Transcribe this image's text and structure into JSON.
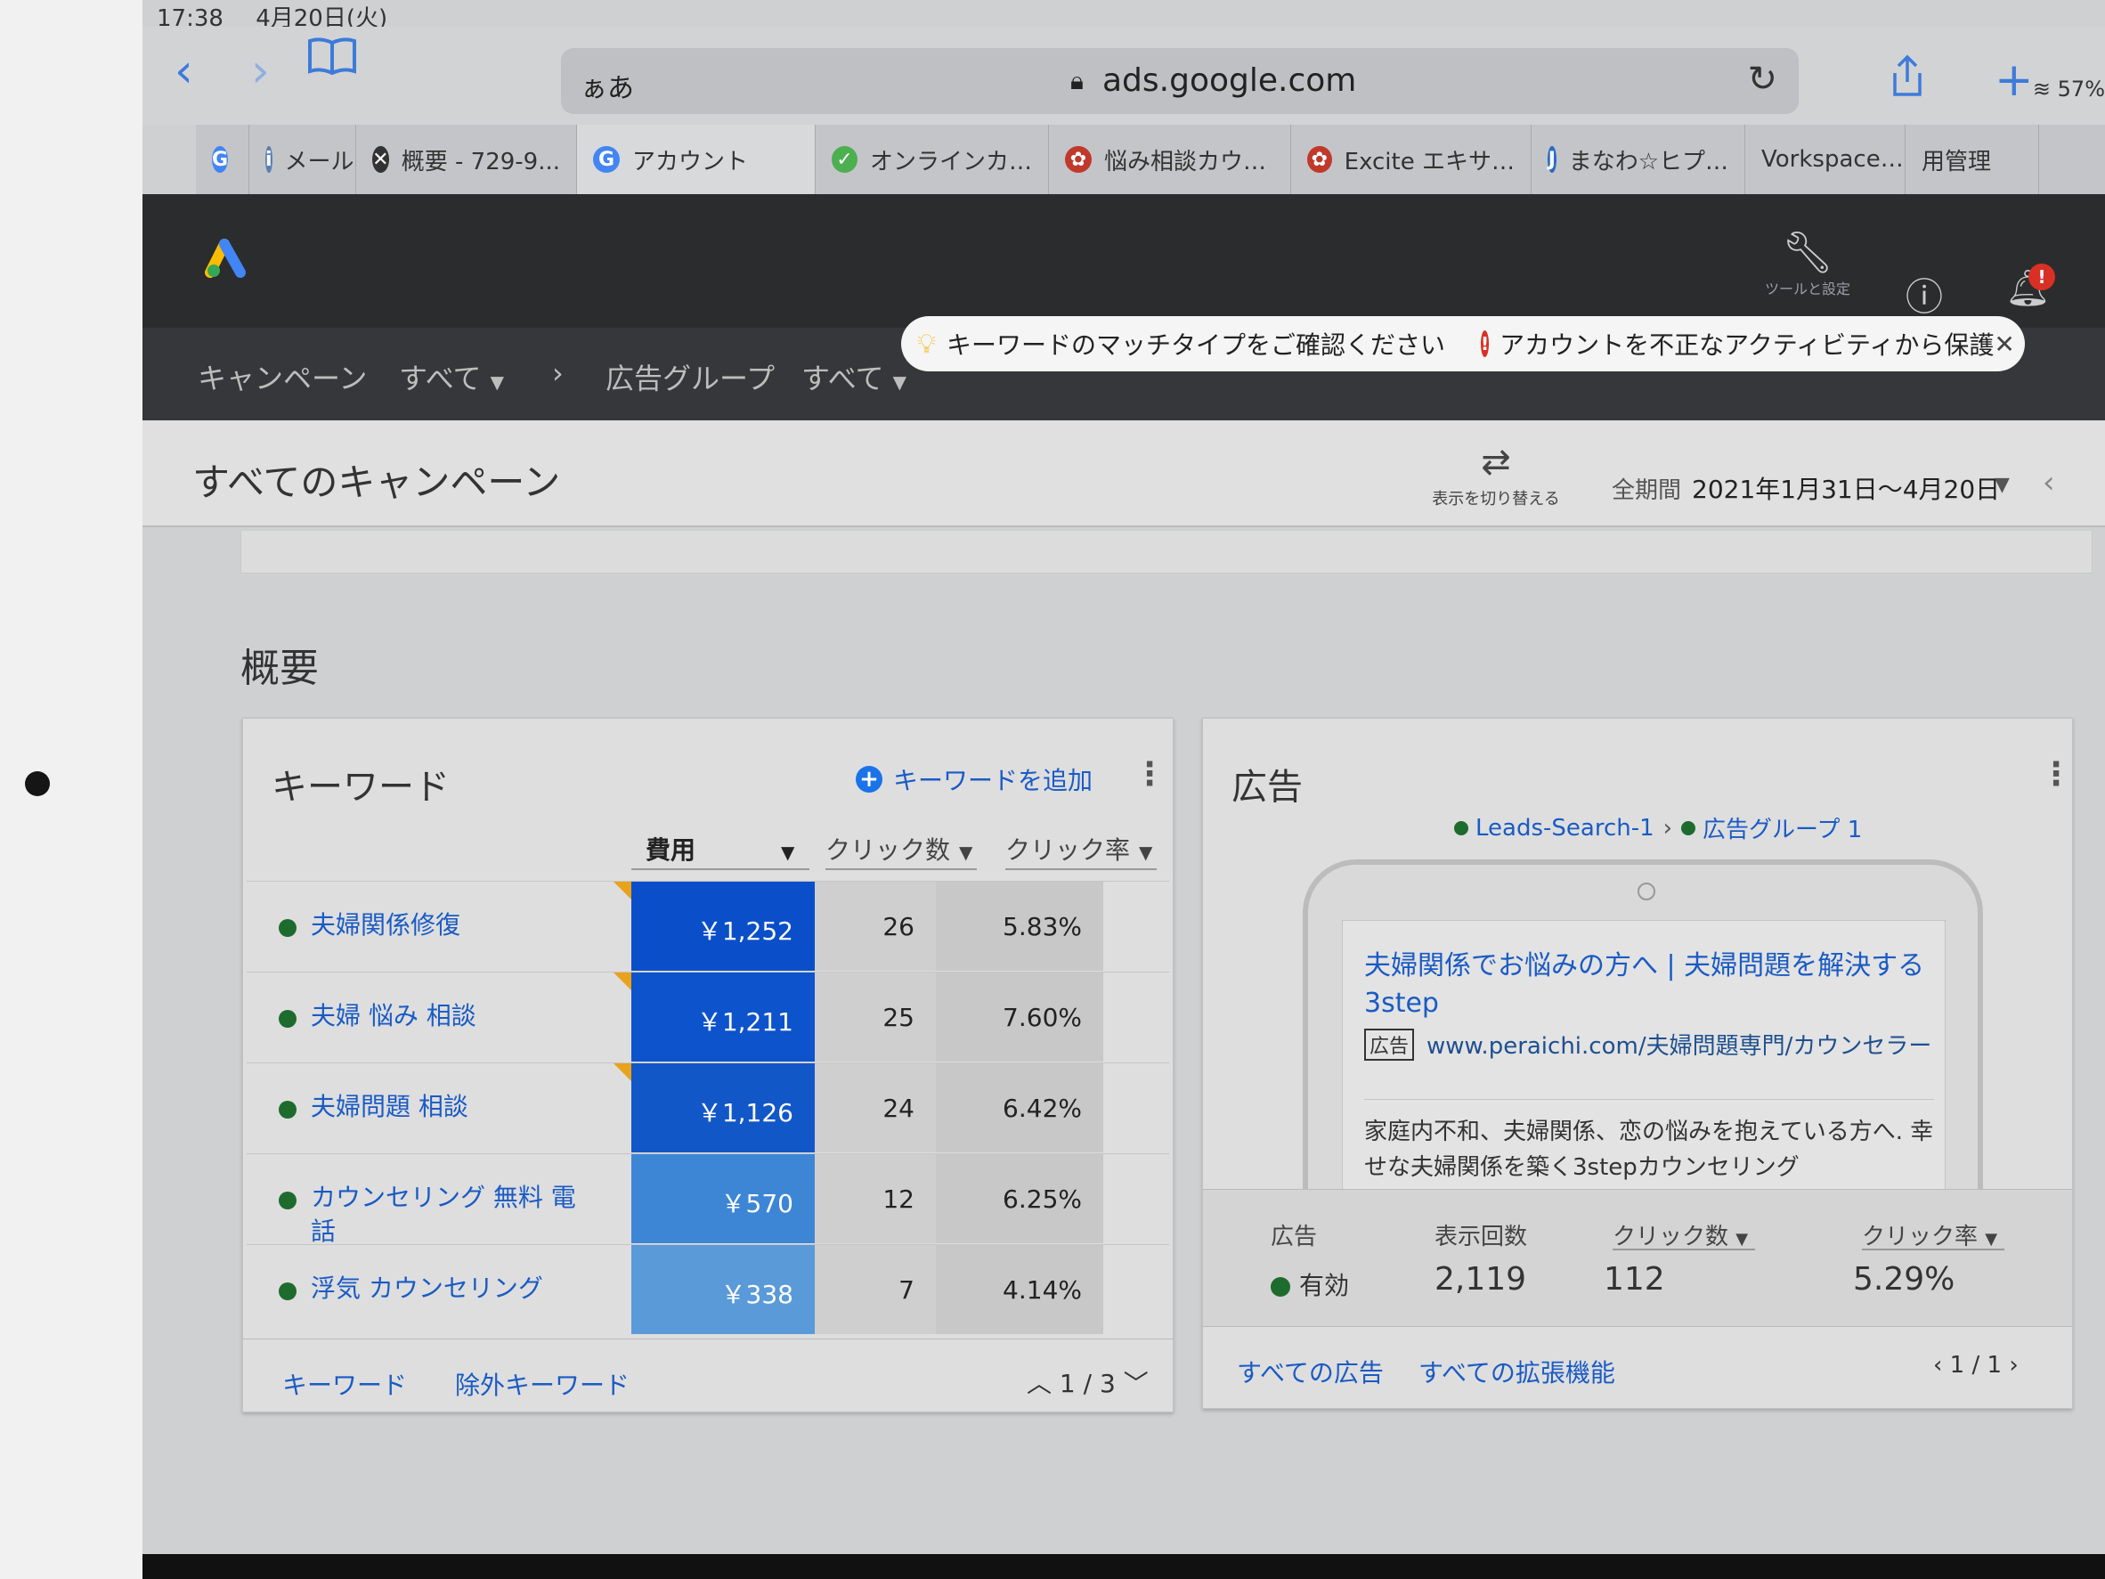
{
  "status_bar": {
    "time": "17:38",
    "date": "4月20日(火)",
    "battery": "57%"
  },
  "safari": {
    "aa_label": "ぁあ",
    "url": "ads.google.com",
    "tabs": [
      {
        "label": "",
        "icon": "G",
        "color": "#4285f4"
      },
      {
        "label": "メール",
        "icon": "i",
        "color": "#5b7fb5"
      },
      {
        "label": "概要 - 729-9...",
        "icon": "✕",
        "color": "#333333"
      },
      {
        "label": "アカウント",
        "icon": "G",
        "color": "#4285f4"
      },
      {
        "label": "オンラインカ…",
        "icon": "✓",
        "color": "#4caf50"
      },
      {
        "label": "悩み相談カウ…",
        "icon": "✿",
        "color": "#c0392b"
      },
      {
        "label": "Excite エキサ…",
        "icon": "✿",
        "color": "#c0392b"
      },
      {
        "label": "まなわ☆ヒプ…",
        "icon": "J",
        "color": "#2a6cc6"
      },
      {
        "label": "Vorkspace…",
        "icon": "",
        "color": "#777777"
      },
      {
        "label": "用管理",
        "icon": "",
        "color": "#777777"
      }
    ]
  },
  "ads_header": {
    "tools_label": "ツールと設定"
  },
  "breadcrumbs": {
    "campaign_label": "キャンペーン",
    "campaign_value": "すべて",
    "adgroup_label": "広告グループ",
    "adgroup_value": "すべて"
  },
  "notice": {
    "tip": "キーワードのマッチタイプをご確認ください",
    "warning": "アカウントを不正なアクティビティから保護"
  },
  "page": {
    "title": "すべてのキャンペーン",
    "switch_label": "表示を切り替える",
    "period_label": "全期間",
    "period_value": "2021年1月31日〜4月20日"
  },
  "overview_title": "概要",
  "keywords_card": {
    "title": "キーワード",
    "add_label": "キーワードを追加",
    "columns": {
      "cost": "費用",
      "clicks": "クリック数",
      "ctr": "クリック率"
    },
    "rows": [
      {
        "keyword": "夫婦関係修復",
        "cost": "￥1,252",
        "clicks": "26",
        "ctr": "5.83%",
        "shade": "#0a4fc9"
      },
      {
        "keyword": "夫婦 悩み 相談",
        "cost": "￥1,211",
        "clicks": "25",
        "ctr": "7.60%",
        "shade": "#0d53cc"
      },
      {
        "keyword": "夫婦問題 相談",
        "cost": "￥1,126",
        "clicks": "24",
        "ctr": "6.42%",
        "shade": "#1257c8"
      },
      {
        "keyword": "カウンセリング 無料 電話",
        "cost": "￥570",
        "clicks": "12",
        "ctr": "6.25%",
        "shade": "#3d86d6"
      },
      {
        "keyword": "浮気 カウンセリング",
        "cost": "￥338",
        "clicks": "7",
        "ctr": "4.14%",
        "shade": "#5a9ad8"
      }
    ],
    "footer": {
      "link1": "キーワード",
      "link2": "除外キーワード",
      "pager": "1 / 3"
    }
  },
  "ads_card": {
    "title": "広告",
    "campaign": "Leads-Search-1",
    "adgroup": "広告グループ 1",
    "ad": {
      "headline": "夫婦関係でお悩みの方へ | 夫婦問題を解決する3step",
      "tag": "広告",
      "display_url": "www.peraichi.com/夫婦問題専門/カウンセラー",
      "description": "家庭内不和、夫婦関係、恋の悩みを抱えている方へ. 幸せな夫婦関係を築く3stepカウンセリング"
    },
    "stats": {
      "ad_header": "広告",
      "ad_value": "有効",
      "impressions_header": "表示回数",
      "impressions_value": "2,119",
      "clicks_header": "クリック数",
      "clicks_value": "112",
      "ctr_header": "クリック率",
      "ctr_value": "5.29%"
    },
    "footer": {
      "link1": "すべての広告",
      "link2": "すべての拡張機能",
      "pager": "1 / 1"
    }
  }
}
